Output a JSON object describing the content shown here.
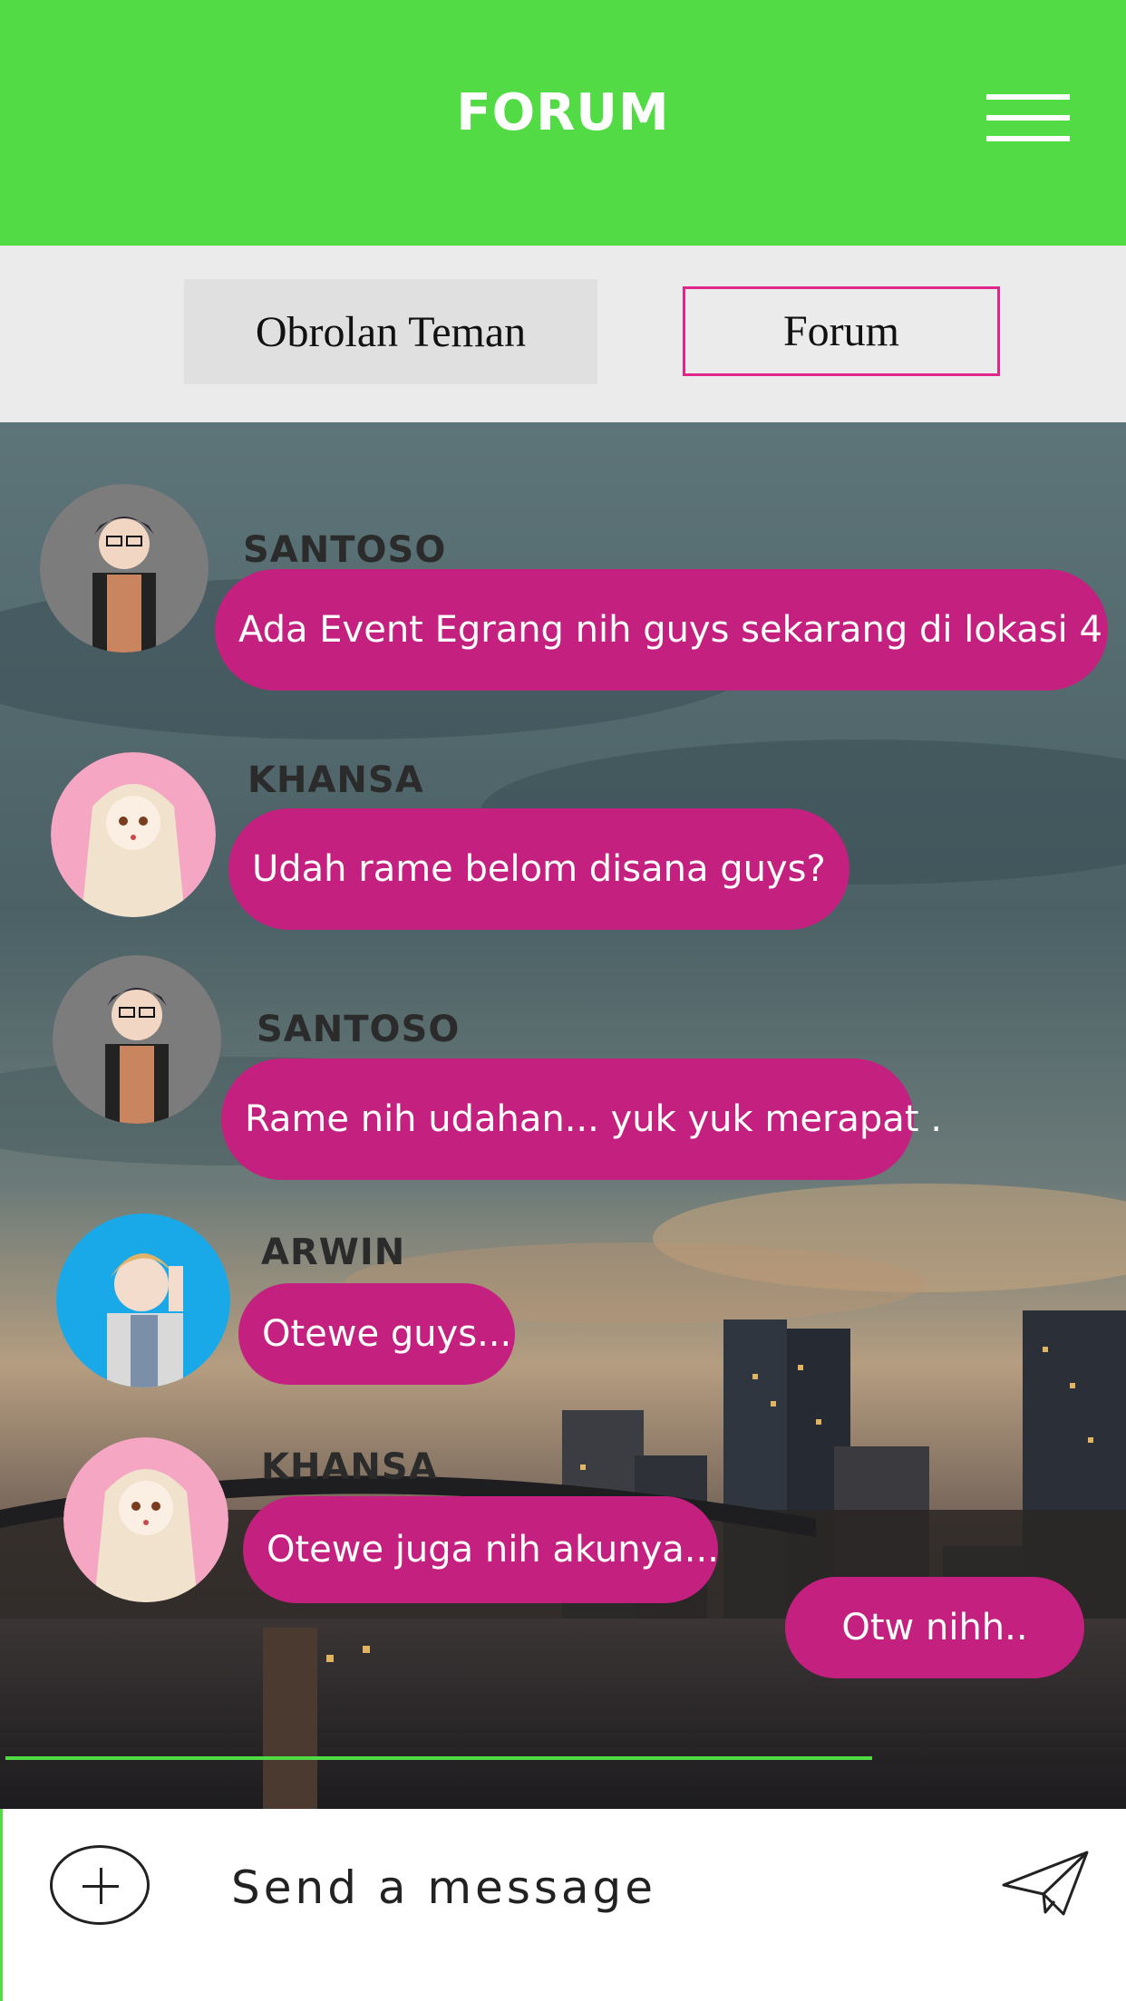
{
  "header": {
    "title": "FORUM",
    "menu_icon": "hamburger-menu-icon"
  },
  "tabs": [
    {
      "label": "Obrolan Teman",
      "active": false
    },
    {
      "label": "Forum",
      "active": true
    }
  ],
  "messages": [
    {
      "name": "SANTOSO",
      "text": "Ada Event Egrang nih guys sekarang di lokasi 4",
      "avatar": "santoso"
    },
    {
      "name": "KHANSA",
      "text": "Udah rame belom disana guys?",
      "avatar": "khansa"
    },
    {
      "name": "SANTOSO",
      "text": "Rame nih udahan... yuk yuk merapat .",
      "avatar": "santoso"
    },
    {
      "name": "ARWIN",
      "text": "Otewe guys...",
      "avatar": "arwin"
    },
    {
      "name": "KHANSA",
      "text": "Otewe juga nih akunya...",
      "avatar": "khansa"
    }
  ],
  "own_message": {
    "text": "Otw nihh.."
  },
  "composer": {
    "placeholder": "Send a message",
    "add_icon": "plus-circle-icon",
    "send_icon": "paper-plane-icon"
  },
  "colors": {
    "header": "#52db45",
    "bubble": "#c4207f",
    "tab_border": "#e0268a"
  }
}
